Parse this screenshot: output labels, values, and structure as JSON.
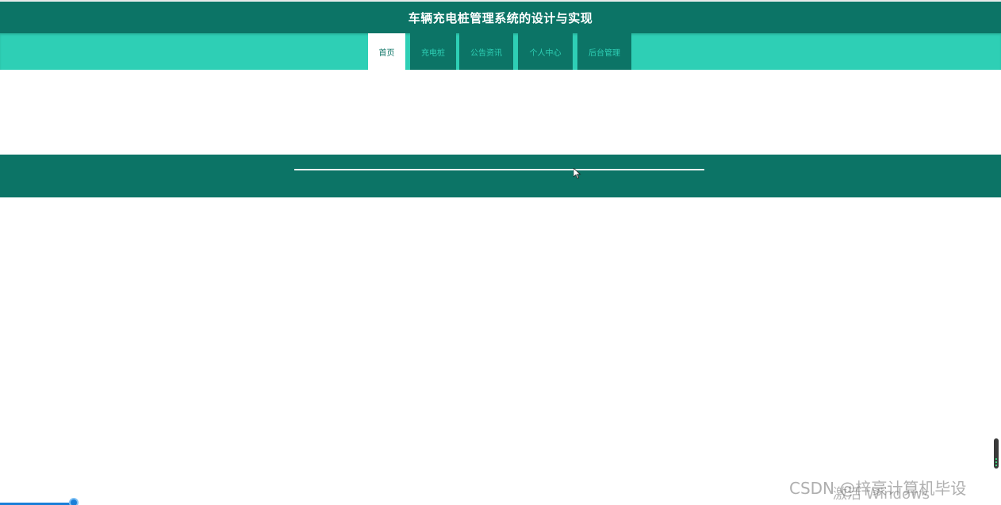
{
  "header": {
    "title": "车辆充电桩管理系统的设计与实现"
  },
  "nav": {
    "items": [
      {
        "label": "首页",
        "active": true
      },
      {
        "label": "充电桩",
        "active": false
      },
      {
        "label": "公告资讯",
        "active": false
      },
      {
        "label": "个人中心",
        "active": false
      },
      {
        "label": "后台管理",
        "active": false
      }
    ]
  },
  "overlay": {
    "activate_windows": "激活 Windows",
    "watermark": "CSDN @梓豪计算机毕设"
  },
  "colors": {
    "header_bg": "#0c7466",
    "nav_bg": "#2ecfb5",
    "banner_bg": "#0c7466",
    "active_tab_bg": "#ffffff"
  },
  "icons": {
    "cursor": "mouse-pointer-icon"
  }
}
